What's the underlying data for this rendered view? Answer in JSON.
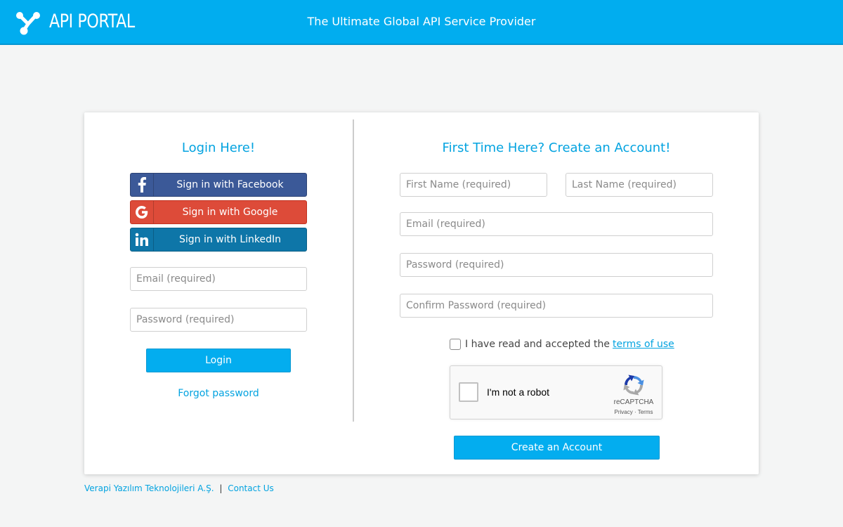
{
  "header": {
    "logo_text": "API PORTAL",
    "tagline": "The Ultimate Global API Service Provider"
  },
  "login": {
    "heading": "Login Here!",
    "social": {
      "facebook": "Sign in with Facebook",
      "google": "Sign in with Google",
      "linkedin": "Sign in with LinkedIn"
    },
    "email_placeholder": "Email (required)",
    "password_placeholder": "Password (required)",
    "login_button": "Login",
    "forgot_password": "Forgot password"
  },
  "register": {
    "heading": "First Time Here? Create an Account!",
    "first_name_placeholder": "First Name (required)",
    "last_name_placeholder": "Last Name (required)",
    "email_placeholder": "Email (required)",
    "password_placeholder": "Password (required)",
    "confirm_password_placeholder": "Confirm Password (required)",
    "terms_text": "I have read and accepted the",
    "terms_link": "terms of use",
    "create_button": "Create an Account"
  },
  "recaptcha": {
    "label": "I'm not a robot",
    "brand": "reCAPTCHA",
    "links": "Privacy · Terms"
  },
  "footer": {
    "company": "Verapi Yazılım Teknolojileri A.Ş.",
    "separator": "|",
    "contact": "Contact Us"
  },
  "colors": {
    "primary": "#01adef",
    "facebook": "#3b5998",
    "google": "#dd4b39",
    "linkedin": "#0e76a8",
    "background": "#f4f5f5"
  },
  "icons": {
    "logo": "network-nodes-icon",
    "facebook": "facebook-icon",
    "google": "google-icon",
    "linkedin": "linkedin-icon",
    "recaptcha": "recaptcha-icon"
  }
}
